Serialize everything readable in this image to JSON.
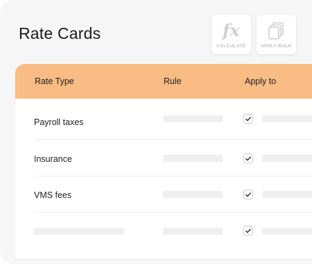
{
  "page": {
    "title": "Rate Cards"
  },
  "toolbar": {
    "calculate_label": "CALCULATE",
    "calculate_icon": "fx-icon",
    "calculate_glyph": "fx",
    "apply_bulk_label": "APPLY BULK",
    "apply_bulk_icon": "stacked-pages-icon"
  },
  "table": {
    "header_color": "#f9bc84",
    "columns": [
      "Rate Type",
      "Rule",
      "Apply to"
    ],
    "rows": [
      {
        "rate_type": "Payroll taxes",
        "checked": true
      },
      {
        "rate_type": "Insurance",
        "checked": true
      },
      {
        "rate_type": "VMS fees",
        "checked": true
      },
      {
        "rate_type": "",
        "checked": true
      }
    ]
  }
}
